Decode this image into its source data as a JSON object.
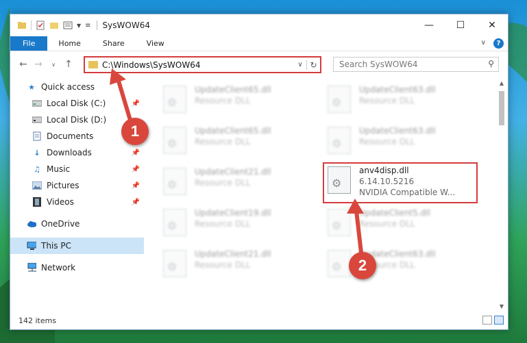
{
  "window": {
    "title": "SysWOW64"
  },
  "ribbon": {
    "tabs": [
      "File",
      "Home",
      "Share",
      "View"
    ]
  },
  "address": {
    "path": "C:\\Windows\\SysWOW64"
  },
  "search": {
    "placeholder": "Search SysWOW64"
  },
  "sidebar": {
    "items": [
      {
        "label": "Quick access",
        "icon": "star-icon"
      },
      {
        "label": "Local Disk (C:)",
        "icon": "drive-icon",
        "pinned": true
      },
      {
        "label": "Local Disk (D:)",
        "icon": "drive-icon"
      },
      {
        "label": "Documents",
        "icon": "documents-icon",
        "pinned": true
      },
      {
        "label": "Downloads",
        "icon": "download-icon",
        "pinned": true
      },
      {
        "label": "Music",
        "icon": "music-icon",
        "pinned": true
      },
      {
        "label": "Pictures",
        "icon": "pictures-icon",
        "pinned": true
      },
      {
        "label": "Videos",
        "icon": "videos-icon",
        "pinned": true
      },
      {
        "label": "OneDrive",
        "icon": "cloud-icon"
      },
      {
        "label": "This PC",
        "icon": "computer-icon",
        "selected": true
      },
      {
        "label": "Network",
        "icon": "network-icon"
      }
    ]
  },
  "files": {
    "left": [
      {
        "name": "UpdateClient65.dll",
        "type": "Resource DLL"
      },
      {
        "name": "UpdateClient65.dll",
        "type": "Resource DLL"
      },
      {
        "name": "UpdateClient21.dll",
        "type": "Resource DLL"
      },
      {
        "name": "UpdateClient19.dll",
        "type": "Resource DLL"
      },
      {
        "name": "UpdateClient21.dll",
        "type": "Resource DLL"
      }
    ],
    "right": [
      {
        "name": "UpdateClient63.dll",
        "type": "Resource DLL"
      },
      {
        "name": "UpdateClient63.dll",
        "type": "Resource DLL"
      },
      {
        "name": "UpdateClient5.dll",
        "type": "Resource DLL"
      },
      {
        "name": "UpdateClient63.dll",
        "type": "Resource DLL"
      }
    ],
    "highlighted": {
      "name": "anv4disp.dll",
      "version": "6.14.10.5216",
      "description": "NVIDIA Compatible W..."
    }
  },
  "status": {
    "item_count": "142 items"
  },
  "callouts": {
    "step1": "1",
    "step2": "2"
  },
  "colors": {
    "accent": "#1979ca",
    "highlight_box": "#d33b3b",
    "badge": "#d9473c"
  }
}
